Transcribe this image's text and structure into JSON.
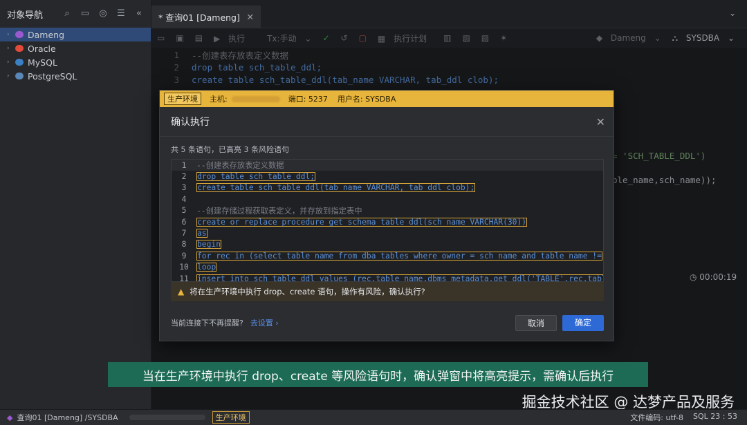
{
  "sidebar": {
    "title": "对象导航",
    "icons": [
      "search-icon",
      "folder-add-icon",
      "target-icon",
      "list-icon",
      "collapse-icon"
    ],
    "databases": [
      {
        "label": "Dameng",
        "color": "#9b59d0",
        "selected": true
      },
      {
        "label": "Oracle",
        "color": "#e04b3a",
        "selected": false
      },
      {
        "label": "MySQL",
        "color": "#3b7fc4",
        "selected": false
      },
      {
        "label": "PostgreSQL",
        "color": "#5a86b8",
        "selected": false
      }
    ]
  },
  "editor": {
    "tab_title": "* 查询01 [Dameng]",
    "toolbar": {
      "execute": "执行",
      "tx": "Tx:手动",
      "plan": "执行计划",
      "conn": "Dameng",
      "user": "SYSDBA"
    },
    "lines": [
      "--创建表存放表定义数据",
      "drop table sch_table_ddl;",
      "create table sch_table_ddl(tab_name VARCHAR, tab_ddl clob);"
    ],
    "behind_text_1": "= 'SCH_TABLE_DDL')",
    "behind_text_2": "ble_name,sch_name));",
    "runtime": "00:00:19"
  },
  "dialog": {
    "env_tag": "生产环境",
    "host_label": "主机:",
    "port": "端口: 5237",
    "username": "用户名: SYSDBA",
    "title": "确认执行",
    "summary": "共 5 条语句，已高亮 3 条风险语句",
    "code": [
      "--创建表存放表定义数据",
      "drop table sch_table_ddl;",
      "create table sch_table_ddl(tab_name VARCHAR, tab_ddl clob);",
      "",
      "--创建存储过程获取表定义，并存放到指定表中",
      "create or replace procedure get_schema_table_ddl(sch_name VARCHAR(30))",
      "as",
      "begin",
      "for rec in (select table_name from dba_tables where owner = sch_name and table_name !=",
      "loop",
      "insert into sch_table_ddl values (rec.table_name,dbms_metadata.get_ddl('TABLE',rec.tabl"
    ],
    "warning": "将在生产环境中执行 drop、create 语句，操作有风险，确认执行?",
    "footer_text": "当前连接下不再提醒?",
    "footer_link": "去设置 ›",
    "cancel": "取消",
    "confirm": "确定"
  },
  "caption": "当在生产环境中执行 drop、create 等风险语句时，确认弹窗中将高亮提示，需确认后执行",
  "watermark": "掘金技术社区 @ 达梦产品及服务",
  "status": {
    "left": "查询01 [Dameng] /SYSDBA",
    "env": "生产环境",
    "encoding": "文件编码:  utf-8",
    "sql": "SQL 23 : 53"
  }
}
